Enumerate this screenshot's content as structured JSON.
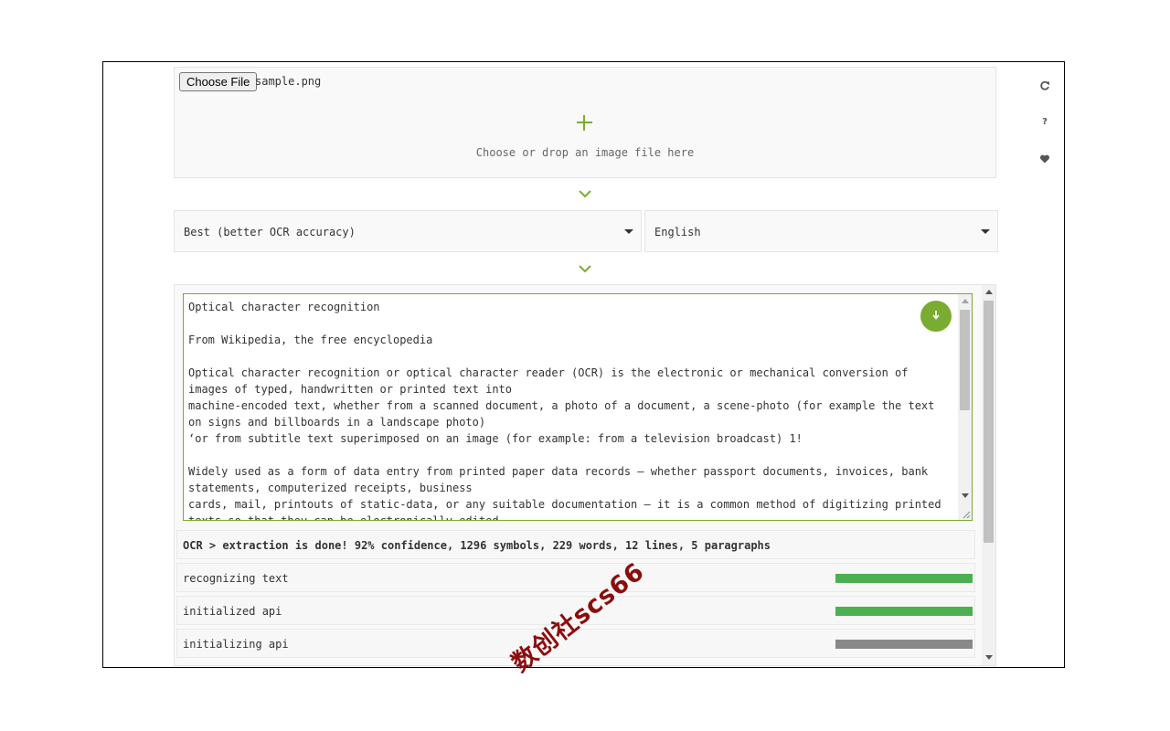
{
  "upload": {
    "button_label": "Choose File",
    "file_name": "sample.png",
    "hint": "Choose or drop an image file here"
  },
  "options": {
    "mode": "Best (better OCR accuracy)",
    "language": "English"
  },
  "result": {
    "paragraphs": [
      [
        "Optical character recognition"
      ],
      [
        "From Wikipedia, the free encyclopedia"
      ],
      [
        "Optical character recognition or optical character reader (OCR) is the electronic or mechanical conversion of images of typed, handwritten or printed text into",
        "machine-encoded text, whether from a scanned document, a photo of a document, a scene-photo (for example the text on signs and billboards in a landscape photo)",
        "‘or from subtitle text superimposed on an image (for example: from a television broadcast) 1!"
      ],
      [
        "Widely used as a form of data entry from printed paper data records — whether passport documents, invoices, bank statements, computerized receipts, business",
        "cards, mail, printouts of static-data, or any suitable documentation — it is a common method of digitizing printed texts so that they can be electronically edited,"
      ]
    ]
  },
  "status": {
    "summary": "OCR > extraction is done! 92% confidence, 1296 symbols, 229 words, 12 lines, 5 paragraphs",
    "steps": [
      {
        "label": "recognizing text",
        "progress": 1.0,
        "color": "#4caf50"
      },
      {
        "label": "initialized api",
        "progress": 1.0,
        "color": "#4caf50"
      },
      {
        "label": "initializing api",
        "progress": 1.0,
        "color": "#888888"
      }
    ]
  },
  "side_icons": [
    "refresh-icon",
    "help-icon",
    "heart-icon"
  ],
  "help_glyph": "?",
  "watermark": "数创社scs66",
  "colors": {
    "accent": "#7aac31",
    "progress_done": "#4caf50",
    "progress_idle": "#888888"
  }
}
